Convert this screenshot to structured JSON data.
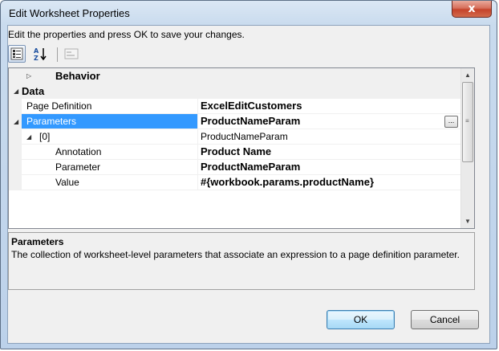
{
  "window": {
    "title": "Edit Worksheet Properties",
    "close_label": "x"
  },
  "instructions": "Edit the properties and press OK to save your changes.",
  "toolbar": {
    "categorized_icon": "categorized-view-icon",
    "alphabetical_icon": "alphabetical-sort-icon",
    "property_pages_icon": "property-pages-icon"
  },
  "grid": {
    "categories": [
      {
        "label": "Behavior",
        "expanded": false
      },
      {
        "label": "Data",
        "expanded": true
      }
    ],
    "rows": [
      {
        "name": "Page Definition",
        "value": "ExcelEditCustomers",
        "bold": true
      },
      {
        "name": "Parameters",
        "value": "ProductNameParam",
        "bold": true,
        "selected": true,
        "has_ellipsis": true,
        "ellipsis_label": "..."
      },
      {
        "name": "[0]",
        "value": "ProductNameParam",
        "bold": false
      },
      {
        "name": "Annotation",
        "value": "Product Name",
        "bold": true
      },
      {
        "name": "Parameter",
        "value": "ProductNameParam",
        "bold": true
      },
      {
        "name": "Value",
        "value": "#{workbook.params.productName}",
        "bold": true
      }
    ]
  },
  "description": {
    "title": "Parameters",
    "text": "The collection of worksheet-level parameters that associate an expression to a page definition parameter."
  },
  "buttons": {
    "ok": "OK",
    "cancel": "Cancel"
  },
  "colors": {
    "selection": "#3399ff",
    "accent": "#c5432b"
  }
}
